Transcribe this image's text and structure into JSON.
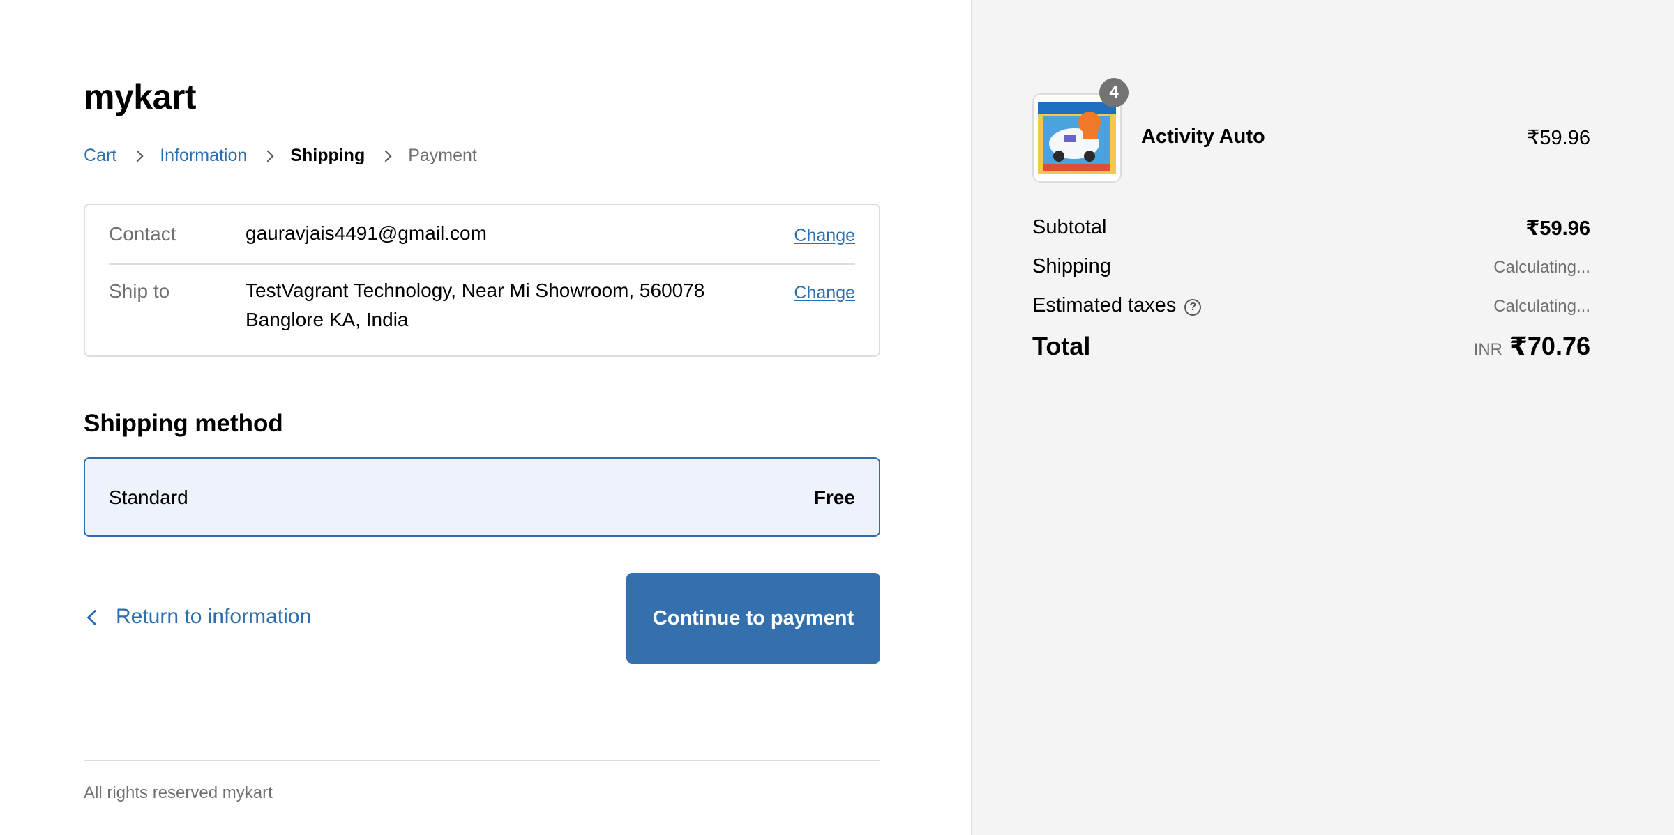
{
  "brand": {
    "name": "mykart"
  },
  "breadcrumb": {
    "items": [
      {
        "label": "Cart"
      },
      {
        "label": "Information"
      },
      {
        "label": "Shipping"
      },
      {
        "label": "Payment"
      }
    ]
  },
  "review": {
    "contact_label": "Contact",
    "contact_value": "gauravjais4491@gmail.com",
    "ship_to_label": "Ship to",
    "ship_to_line1": "TestVagrant Technology, Near Mi Showroom, 560078",
    "ship_to_line2": "Banglore KA, India",
    "change_label": "Change"
  },
  "shipping_method": {
    "title": "Shipping method",
    "name": "Standard",
    "price": "Free"
  },
  "actions": {
    "return_label": "Return to information",
    "continue_label": "Continue to payment"
  },
  "footer": {
    "text": "All rights reserved mykart"
  },
  "order": {
    "item": {
      "name": "Activity Auto",
      "price": "₹59.96",
      "quantity": "4"
    },
    "subtotal_label": "Subtotal",
    "subtotal_value": "₹59.96",
    "shipping_label": "Shipping",
    "shipping_value": "Calculating...",
    "taxes_label": "Estimated taxes",
    "taxes_value": "Calculating...",
    "help_icon": "question-circle-icon",
    "total_label": "Total",
    "total_currency": "INR",
    "total_value": "₹70.76"
  },
  "colors": {
    "accent": "#2d6ead",
    "button": "#3470ad",
    "sidebar_bg": "#f4f4f4",
    "selected_bg": "#eef3fb"
  }
}
